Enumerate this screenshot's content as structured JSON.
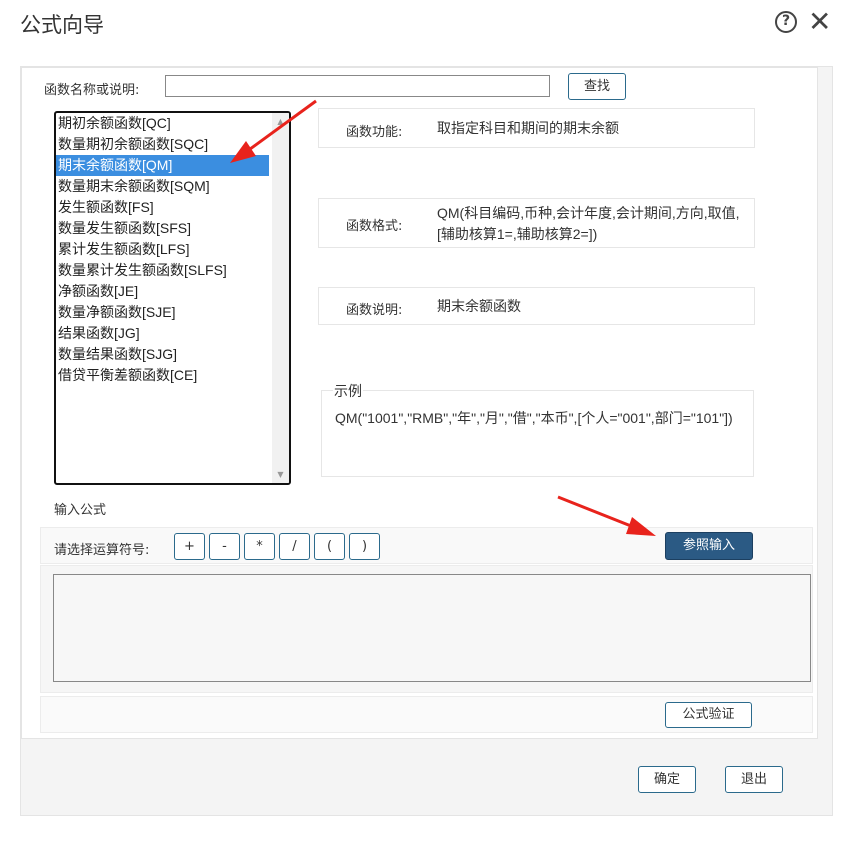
{
  "dialog": {
    "title": "公式向导",
    "help_icon": "question-circle-icon",
    "close_icon": "close-x-icon"
  },
  "search": {
    "label": "函数名称或说明:",
    "value": "",
    "button": "查找"
  },
  "function_list": {
    "items": [
      "期初余额函数[QC]",
      "数量期初余额函数[SQC]",
      "期末余额函数[QM]",
      "数量期末余额函数[SQM]",
      "发生额函数[FS]",
      "数量发生额函数[SFS]",
      "累计发生额函数[LFS]",
      "数量累计发生额函数[SLFS]",
      "净额函数[JE]",
      "数量净额函数[SJE]",
      "结果函数[JG]",
      "数量结果函数[SJG]",
      "借贷平衡差额函数[CE]"
    ],
    "selected": "期末余额函数[QM]"
  },
  "info": {
    "function_label": "函数功能:",
    "function_value": "取指定科目和期间的期末余额",
    "format_label": "函数格式:",
    "format_value": "QM(科目编码,币种,会计年度,会计期间,方向,取值,[辅助核算1=,辅助核算2=])",
    "desc_label": "函数说明:",
    "desc_value": "期末余额函数"
  },
  "example": {
    "legend": "示例",
    "text": "QM(\"1001\",\"RMB\",\"年\",\"月\",\"借\",\"本币\",[个人=\"001\",部门=\"101\"])"
  },
  "formula": {
    "section_label": "输入公式",
    "operator_label": "请选择运算符号:",
    "operators": [
      "+",
      "-",
      "*",
      "/",
      "(",
      ")"
    ],
    "reference_button": "参照输入",
    "value": "",
    "verify_button": "公式验证"
  },
  "footer": {
    "ok_button": "确定",
    "exit_button": "退出"
  },
  "colors": {
    "selected_bg": "#3b8ee0",
    "primary_button": "#2b5a84",
    "button_border": "#2b6a8c",
    "annotation_arrow": "#e8231c"
  }
}
